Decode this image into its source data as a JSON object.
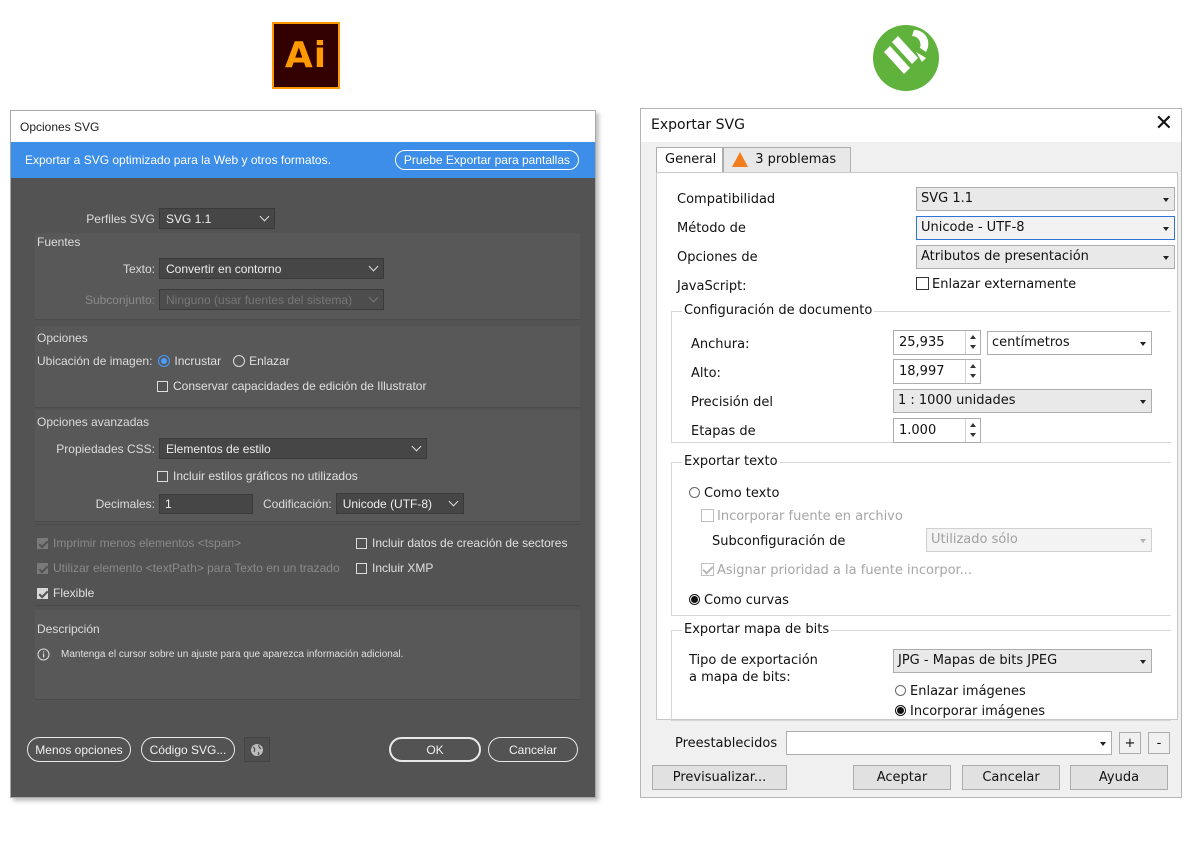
{
  "ai_logo": {
    "text": "Ai",
    "brand_color": "#ff9a00",
    "bg_color": "#330000"
  },
  "cd_logo": {
    "icon": "coreldraw-balloon-logo",
    "brand_color": "#5fb23b"
  },
  "illustrator": {
    "title": "Opciones SVG",
    "banner_text": "Exportar a SVG optimizado para la Web y otros formatos.",
    "banner_button": "Pruebe Exportar para pantallas",
    "accent_color": "#3c8ee8",
    "profiles_label": "Perfiles SVG",
    "profiles_value": "SVG 1.1",
    "fonts_section": "Fuentes",
    "text_label": "Texto:",
    "text_value": "Convertir en contorno",
    "subset_label": "Subconjunto:",
    "subset_value": "Ninguno (usar fuentes del sistema)",
    "options_section": "Opciones",
    "image_location_label": "Ubicación de imagen:",
    "embed_label": "Incrustar",
    "link_label": "Enlazar",
    "preserve_label": "Conservar capacidades de edición de Illustrator",
    "advanced_section": "Opciones avanzadas",
    "css_label": "Propiedades CSS:",
    "css_value": "Elementos de estilo",
    "unused_styles_label": "Incluir estilos gráficos no utilizados",
    "decimals_label": "Decimales:",
    "decimals_value": "1",
    "encoding_label": "Codificación:",
    "encoding_value": "Unicode (UTF-8)",
    "tspan_label": "Imprimir menos elementos <tspan>",
    "slices_label": "Incluir datos de creación de sectores",
    "textpath_label": "Utilizar elemento <textPath> para Texto en un trazado",
    "xmp_label": "Incluir XMP",
    "responsive_label": "Flexible",
    "description_section": "Descripción",
    "description_text": "Mantenga el cursor sobre un ajuste para que aparezca información adicional.",
    "less_options_button": "Menos opciones",
    "svg_code_button": "Código SVG...",
    "ok_button": "OK",
    "cancel_button": "Cancelar"
  },
  "corel": {
    "title": "Exportar SVG",
    "tab_general": "General",
    "tab_problems": "3 problemas",
    "compat_label": "Compatibilidad",
    "compat_value": "SVG 1.1",
    "method_label": "Método de",
    "method_value": "Unicode - UTF-8",
    "options_label": "Opciones de",
    "options_value": "Atributos de presentación",
    "js_label": "JavaScript:",
    "js_link_label": "Enlazar externamente",
    "doc_group": "Configuración de documento",
    "width_label": "Anchura:",
    "width_value": "25,935",
    "units_value": "centímetros",
    "height_label": "Alto:",
    "height_value": "18,997",
    "precision_label": "Precisión del",
    "precision_value": "1 : 1000 unidades",
    "steps_label": "Etapas de",
    "steps_value": "1.000",
    "text_group": "Exportar texto",
    "as_text_label": "Como texto",
    "embed_font_label": "Incorporar fuente en archivo",
    "subconfig_label": "Subconfiguración de",
    "subconfig_value": "Utilizado sólo",
    "priority_label": "Asignar prioridad a la fuente incorpor...",
    "as_curves_label": "Como curvas",
    "bitmap_group": "Exportar mapa de bits",
    "bitmap_type_label_1": "Tipo de exportación",
    "bitmap_type_label_2": "a mapa de bits:",
    "bitmap_type_value": "JPG - Mapas de bits JPEG",
    "link_images_label": "Enlazar imágenes",
    "embed_images_label": "Incorporar imágenes",
    "presets_label": "Preestablecidos",
    "presets_value": "",
    "add_label": "+",
    "remove_label": "-",
    "preview_button": "Previsualizar...",
    "accept_button": "Aceptar",
    "cancel_button": "Cancelar",
    "help_button": "Ayuda"
  }
}
